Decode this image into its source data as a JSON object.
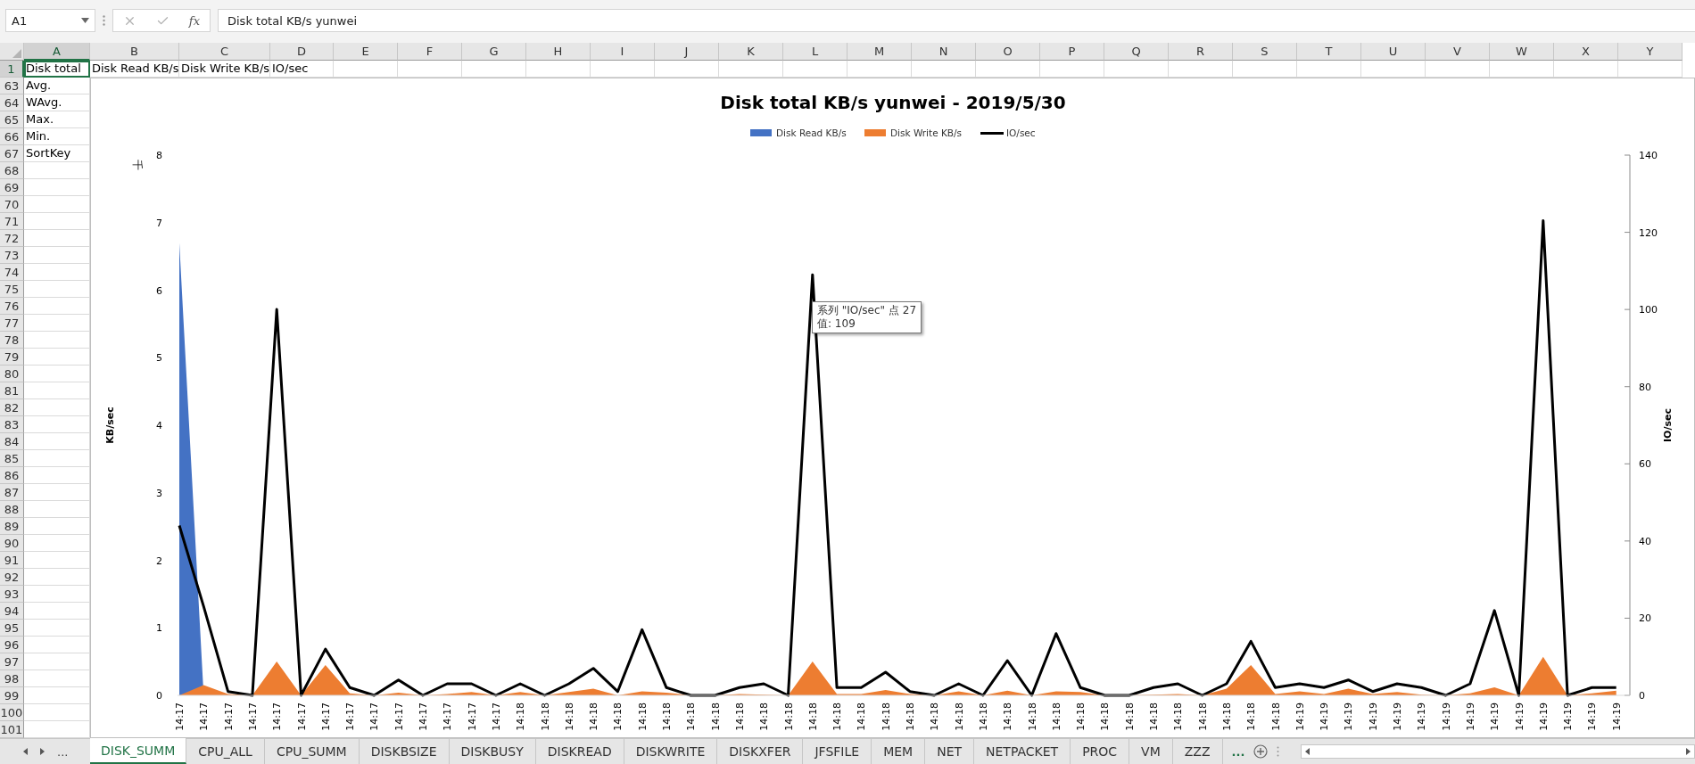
{
  "name_box": {
    "value": "A1"
  },
  "formula_bar": {
    "function_label": "fx",
    "value": "Disk total KB/s yunwei"
  },
  "columns": [
    {
      "label": "A",
      "selected": true
    },
    {
      "label": "B",
      "selected": false
    },
    {
      "label": "C",
      "selected": false
    },
    {
      "label": "D",
      "selected": false
    },
    {
      "label": "E",
      "selected": false
    },
    {
      "label": "F",
      "selected": false
    },
    {
      "label": "G",
      "selected": false
    },
    {
      "label": "H",
      "selected": false
    },
    {
      "label": "I",
      "selected": false
    },
    {
      "label": "J",
      "selected": false
    },
    {
      "label": "K",
      "selected": false
    },
    {
      "label": "L",
      "selected": false
    },
    {
      "label": "M",
      "selected": false
    },
    {
      "label": "N",
      "selected": false
    },
    {
      "label": "O",
      "selected": false
    },
    {
      "label": "P",
      "selected": false
    },
    {
      "label": "Q",
      "selected": false
    },
    {
      "label": "R",
      "selected": false
    },
    {
      "label": "S",
      "selected": false
    },
    {
      "label": "T",
      "selected": false
    },
    {
      "label": "U",
      "selected": false
    },
    {
      "label": "V",
      "selected": false
    },
    {
      "label": "W",
      "selected": false
    },
    {
      "label": "X",
      "selected": false
    },
    {
      "label": "Y",
      "selected": false
    }
  ],
  "header_row": {
    "label": "1",
    "selected": true,
    "cells": [
      "Disk total",
      "Disk Read KB/s",
      "Disk Write KB/s",
      "IO/sec"
    ]
  },
  "rows": [
    {
      "label": "63",
      "cell": "Avg."
    },
    {
      "label": "64",
      "cell": "WAvg."
    },
    {
      "label": "65",
      "cell": "Max."
    },
    {
      "label": "66",
      "cell": "Min."
    },
    {
      "label": "67",
      "cell": "SortKey"
    },
    {
      "label": "68"
    },
    {
      "label": "69"
    },
    {
      "label": "70"
    },
    {
      "label": "71"
    },
    {
      "label": "72"
    },
    {
      "label": "73"
    },
    {
      "label": "74"
    },
    {
      "label": "75"
    },
    {
      "label": "76"
    },
    {
      "label": "77"
    },
    {
      "label": "78"
    },
    {
      "label": "79"
    },
    {
      "label": "80"
    },
    {
      "label": "81"
    },
    {
      "label": "82"
    },
    {
      "label": "83"
    },
    {
      "label": "84"
    },
    {
      "label": "85"
    },
    {
      "label": "86"
    },
    {
      "label": "87"
    },
    {
      "label": "88"
    },
    {
      "label": "89"
    },
    {
      "label": "90"
    },
    {
      "label": "91"
    },
    {
      "label": "92"
    },
    {
      "label": "93"
    },
    {
      "label": "94"
    },
    {
      "label": "95"
    },
    {
      "label": "96"
    },
    {
      "label": "97"
    },
    {
      "label": "98"
    },
    {
      "label": "99"
    },
    {
      "label": "100"
    },
    {
      "label": "101"
    }
  ],
  "chart": {
    "display_unit": "千",
    "tooltip": [
      "系列 \"IO/sec\" 点 27",
      "值: 109"
    ],
    "chart_data": {
      "type": "area",
      "legend": "top",
      "title": "Disk total KB/s yunwei - 2019/5/30",
      "ylabel": "KB/sec",
      "y2label": "IO/sec",
      "categories": [
        "14:17",
        "14:17",
        "14:17",
        "14:17",
        "14:17",
        "14:17",
        "14:17",
        "14:17",
        "14:17",
        "14:17",
        "14:17",
        "14:17",
        "14:17",
        "14:17",
        "14:18",
        "14:18",
        "14:18",
        "14:18",
        "14:18",
        "14:18",
        "14:18",
        "14:18",
        "14:18",
        "14:18",
        "14:18",
        "14:18",
        "14:18",
        "14:18",
        "14:18",
        "14:18",
        "14:18",
        "14:18",
        "14:18",
        "14:18",
        "14:18",
        "14:18",
        "14:18",
        "14:18",
        "14:18",
        "14:18",
        "14:18",
        "14:18",
        "14:18",
        "14:18",
        "14:18",
        "14:18",
        "14:19",
        "14:19",
        "14:19",
        "14:19",
        "14:19",
        "14:19",
        "14:19",
        "14:19",
        "14:19",
        "14:19",
        "14:19",
        "14:19",
        "14:19",
        "14:19"
      ],
      "series": [
        {
          "name": "Disk Read KB/s",
          "color": "#4472c4",
          "values": [
            6.7,
            0,
            0,
            0,
            0,
            0,
            0,
            0,
            0,
            0,
            0,
            0,
            0,
            0,
            0,
            0,
            0,
            0,
            0,
            0,
            0,
            0,
            0,
            0,
            0,
            0,
            0,
            0,
            0,
            0,
            0,
            0,
            0,
            0,
            0,
            0,
            0,
            0,
            0,
            0,
            0,
            0,
            0,
            0,
            0,
            0,
            0,
            0,
            0,
            0,
            0,
            0,
            0,
            0,
            0,
            0,
            0,
            0,
            0,
            0
          ]
        },
        {
          "name": "Disk Write KB/s",
          "color": "#ed7d31",
          "values": [
            0,
            0.15,
            0.02,
            0,
            0.5,
            0,
            0.45,
            0.03,
            0,
            0.04,
            0,
            0.02,
            0.05,
            0,
            0.05,
            0,
            0.05,
            0.1,
            0,
            0.06,
            0.04,
            0,
            0,
            0.02,
            0.01,
            0,
            0.5,
            0.02,
            0.02,
            0.08,
            0.02,
            0,
            0.06,
            0,
            0.07,
            0,
            0.06,
            0.05,
            0,
            0,
            0.01,
            0.02,
            0,
            0.1,
            0.45,
            0.02,
            0.06,
            0.02,
            0.1,
            0.02,
            0.05,
            0.01,
            0,
            0.03,
            0.12,
            0,
            0.57,
            0,
            0.03,
            0.07
          ]
        },
        {
          "name": "IO/sec",
          "color": "#000000",
          "type": "line",
          "axis": "y2",
          "values": [
            44,
            23,
            1,
            0,
            100,
            0,
            12,
            2,
            0,
            4,
            0,
            3,
            3,
            0,
            3,
            0,
            3,
            7,
            1,
            17,
            2,
            0,
            0,
            2,
            3,
            0,
            109,
            2,
            2,
            6,
            1,
            0,
            3,
            0,
            9,
            0,
            16,
            2,
            0,
            0,
            2,
            3,
            0,
            3,
            14,
            2,
            3,
            2,
            4,
            1,
            3,
            2,
            0,
            3,
            22,
            0,
            123,
            0,
            2,
            2
          ]
        }
      ],
      "ylim": [
        0,
        8
      ],
      "yticks": [
        0,
        1,
        2,
        3,
        4,
        5,
        6,
        7,
        8
      ],
      "y2lim": [
        0,
        140
      ],
      "y2ticks": [
        0,
        20,
        40,
        60,
        80,
        100,
        120,
        140
      ]
    }
  },
  "sheets": {
    "more_left": "...",
    "more_right": "...",
    "tabs": [
      {
        "label": "DISK_SUMM",
        "selected": true
      },
      {
        "label": "CPU_ALL",
        "selected": false
      },
      {
        "label": "CPU_SUMM",
        "selected": false
      },
      {
        "label": "DISKBSIZE",
        "selected": false
      },
      {
        "label": "DISKBUSY",
        "selected": false
      },
      {
        "label": "DISKREAD",
        "selected": false
      },
      {
        "label": "DISKWRITE",
        "selected": false
      },
      {
        "label": "DISKXFER",
        "selected": false
      },
      {
        "label": "JFSFILE",
        "selected": false
      },
      {
        "label": "MEM",
        "selected": false
      },
      {
        "label": "NET",
        "selected": false
      },
      {
        "label": "NETPACKET",
        "selected": false
      },
      {
        "label": "PROC",
        "selected": false
      },
      {
        "label": "VM",
        "selected": false
      },
      {
        "label": "ZZZ",
        "selected": false
      }
    ]
  }
}
